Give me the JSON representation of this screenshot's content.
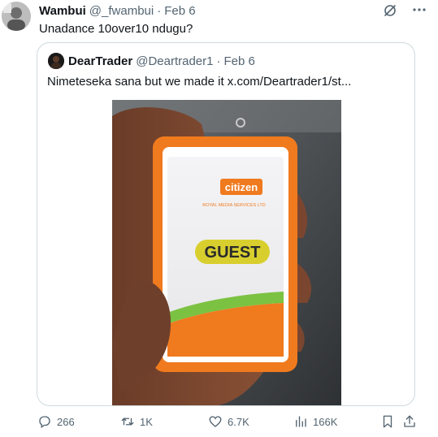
{
  "tweet": {
    "display_name": "Wambui",
    "handle": "@_fwambui",
    "separator": "·",
    "date": "Feb 6",
    "text": "Unadance 10over10 ndugu?"
  },
  "quoted_tweet": {
    "display_name": "DearTrader",
    "handle": "@Deartrader1",
    "separator": "·",
    "date": "Feb 6",
    "text": "Nimeteseka sana but we made it  x.com/Deartrader1/st...",
    "image_badge_brand": "citizen",
    "image_badge_subtitle": "ROYAL MEDIA SERVICES LTD",
    "image_badge_label": "GUEST"
  },
  "actions": {
    "replies": "266",
    "reposts": "1K",
    "likes": "6.7K",
    "views": "166K"
  },
  "colors": {
    "text_primary": "#0f1419",
    "text_secondary": "#536471",
    "border": "#cfd9de",
    "badge_orange": "#f07a1e",
    "badge_green": "#7cc242"
  },
  "icons": {
    "header": [
      "grok-icon",
      "more-icon"
    ],
    "actions": [
      "reply-icon",
      "retweet-icon",
      "like-icon",
      "views-icon",
      "bookmark-icon",
      "share-icon"
    ]
  }
}
